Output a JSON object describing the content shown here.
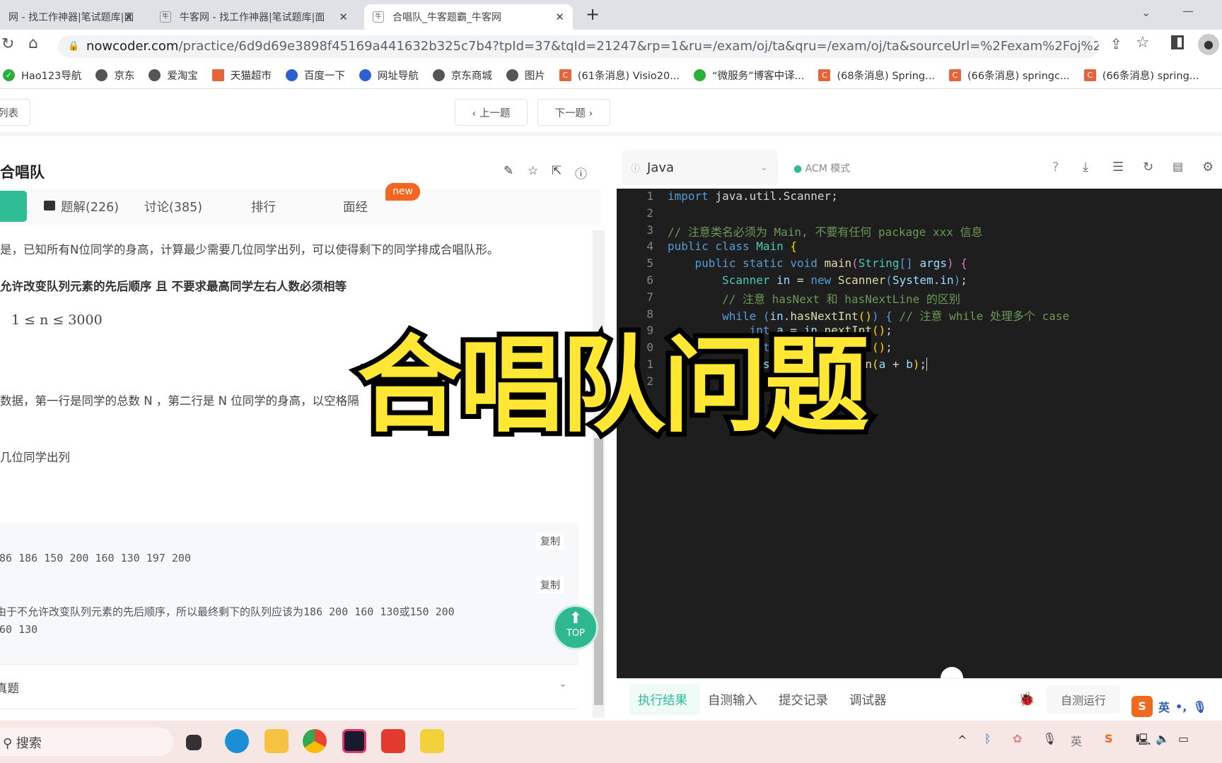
{
  "browser": {
    "tabs": [
      {
        "title": "网 - 找工作神器|笔试题库|面"
      },
      {
        "title": "牛客网 - 找工作神器|笔试题库|面"
      },
      {
        "title": "合唱队_牛客题霸_牛客网",
        "active": true
      }
    ],
    "url_host": "nowcoder.com",
    "url_rest": "/practice/6d9d69e3898f45169a441632b325c7b4?tpId=37&tqId=21247&rp=1&ru=/exam/oj/ta&qru=/exam/oj/ta&sourceUrl=%2Fexam%2Foj%2Fta%3Ft...",
    "bookmarks": [
      "Hao123导航",
      "京东",
      "爱淘宝",
      "天猫超市",
      "百度一下",
      "网址导航",
      "京东商城",
      "图片",
      "(61条消息) Visio20...",
      "“微服务”博客中译...",
      "(68条消息) Spring...",
      "(66条消息) springc...",
      "(66条消息) spring..."
    ]
  },
  "nav": {
    "list": "列表",
    "prev": "‹ 上一题",
    "next": "下一题 ›"
  },
  "problem": {
    "title": "合唱队",
    "tabs": [
      "题解(226)",
      "讨论(385)",
      "排行",
      "面经"
    ],
    "new_badge": "new",
    "desc": "是，已知所有N位同学的身高，计算最少需要几位同学出列，可以使得剩下的同学排成合唱队形。",
    "note": "允许改变队列元素的先后顺序 且 不要求最高同学左右人数必须相等",
    "range": "1 ≤ n ≤ 3000",
    "input_desc": "数据，第一行是同学的总数 N ，第二行是 N 位同学的身高，以空格隔",
    "output_desc": "几位同学出列",
    "copy": "复制",
    "sample_input": "186 186 150 200 160 130 197 200",
    "explain1": "由于不允许改变队列元素的先后顺序，所以最终剩下的队列应该为186 200 160 130或150 200",
    "explain2": "160 130",
    "related": "真题",
    "top": "TOP"
  },
  "editor": {
    "language": "Java",
    "mode": "ACM 模式",
    "line_numbers": [
      "1",
      "2",
      "3",
      "4",
      "5",
      "6",
      "7",
      "8",
      "9",
      "0",
      "1",
      "2"
    ],
    "bottom_tabs": [
      "执行结果",
      "自测输入",
      "提交记录",
      "调试器"
    ],
    "self_test": "自测运行"
  },
  "overlay": {
    "text": "合唱队问题"
  },
  "taskbar": {
    "search": "搜索",
    "ime": "英"
  }
}
